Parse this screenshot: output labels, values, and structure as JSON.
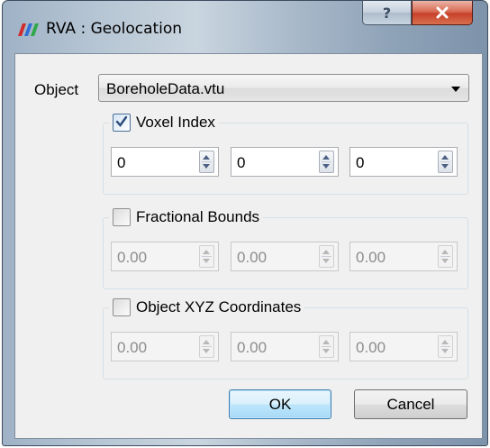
{
  "window": {
    "title": "RVA : Geolocation"
  },
  "object": {
    "label": "Object",
    "value": "BoreholeData.vtu"
  },
  "voxel_index": {
    "label": "Voxel Index",
    "checked": true,
    "values": [
      "0",
      "0",
      "0"
    ]
  },
  "fractional_bounds": {
    "label": "Fractional Bounds",
    "checked": false,
    "values": [
      "0.00",
      "0.00",
      "0.00"
    ]
  },
  "object_xyz": {
    "label": "Object XYZ Coordinates",
    "checked": false,
    "values": [
      "0.00",
      "0.00",
      "0.00"
    ]
  },
  "buttons": {
    "ok": "OK",
    "cancel": "Cancel"
  },
  "colors": {
    "close_button": "#c7412a",
    "default_button": "#3c7fb1"
  }
}
